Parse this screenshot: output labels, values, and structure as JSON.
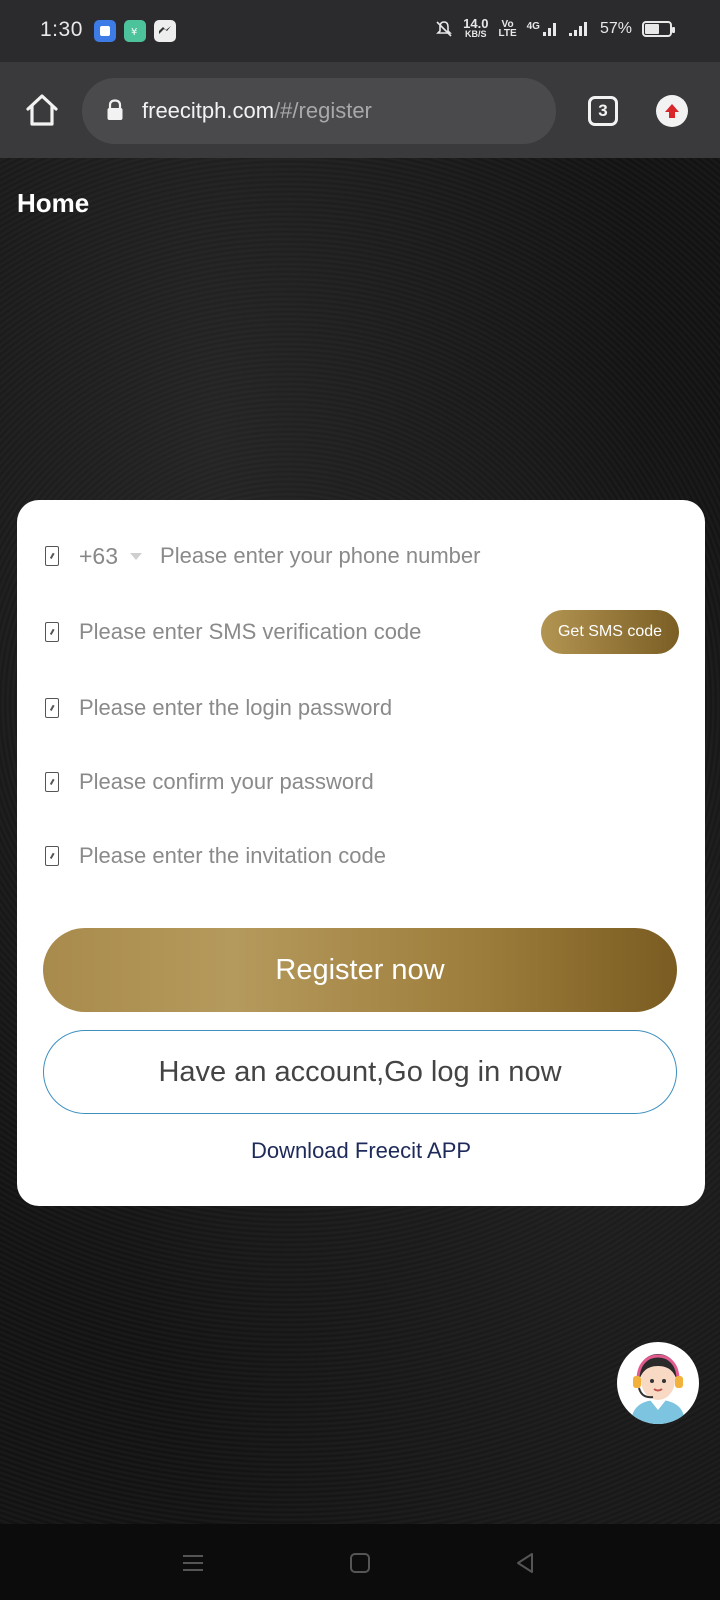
{
  "status_bar": {
    "time": "1:30",
    "net_speed_value": "14.0",
    "net_speed_unit": "KB/S",
    "volte_top": "Vo",
    "volte_bottom": "LTE",
    "network": "4G",
    "battery_percent": "57%",
    "battery_level": 0.57,
    "app_icons": [
      "blue-app-icon",
      "green-app-icon",
      "messenger-app-icon"
    ]
  },
  "browser": {
    "url_domain": "freecitph.com",
    "url_path": "/#/register",
    "tab_count": "3"
  },
  "page": {
    "title": "Home"
  },
  "form": {
    "country_code": "+63",
    "phone_placeholder": "Please enter your phone number",
    "sms_placeholder": "Please enter SMS verification code",
    "sms_button": "Get SMS code",
    "password_placeholder": "Please enter the login password",
    "confirm_placeholder": "Please confirm your password",
    "invite_placeholder": "Please enter the invitation code",
    "register_button": "Register now",
    "login_button": "Have an account,Go log in now",
    "download_link": "Download Freecit APP"
  },
  "colors": {
    "accent_gold": "#a88b4c",
    "accent_gold_dark": "#7a5c22",
    "login_border": "#3d8fbf",
    "link": "#1d2a5a"
  }
}
